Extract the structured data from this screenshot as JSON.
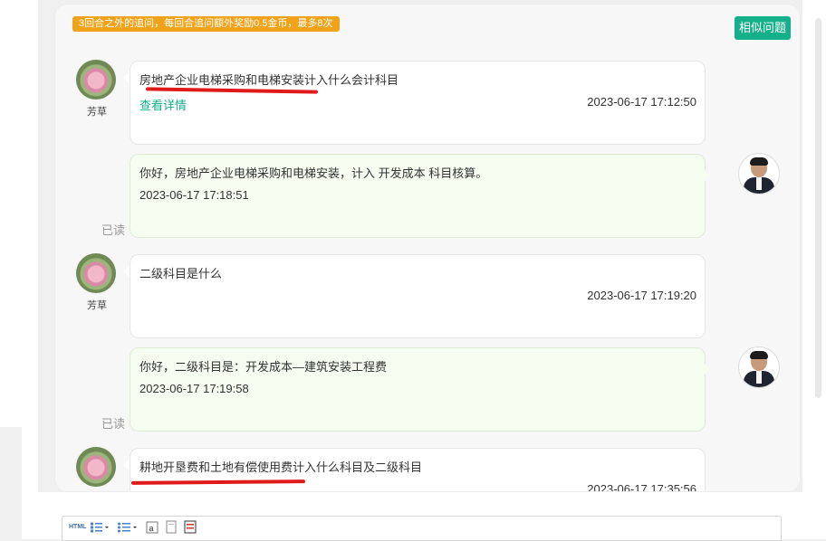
{
  "notice": "3回合之外的追问，每回合追问额外奖励0.5金币，最多8次",
  "similar_button": "相似问题",
  "messages": [
    {
      "user": "芳草",
      "text": "房地产企业电梯采购和电梯安装计入什么会计科目",
      "link": "查看详情",
      "time": "2023-06-17 17:12:50"
    },
    {
      "text": "你好，房地产企业电梯采购和电梯安装，计入  开发成本  科目核算。",
      "time": "2023-06-17 17:18:51",
      "status": "已读"
    },
    {
      "user": "芳草",
      "text": "二级科目是什么",
      "time": "2023-06-17 17:19:20"
    },
    {
      "text": "你好，二级科目是：开发成本—建筑安装工程费",
      "time": "2023-06-17 17:19:58",
      "status": "已读"
    },
    {
      "user": "芳草",
      "text": "耕地开垦费和土地有偿使用费计入什么科目及二级科目",
      "time": "2023-06-17 17:35:56"
    }
  ],
  "toolbar": {
    "html": "HTML",
    "ordered_list_icon": "ordered-list-icon",
    "unordered_list_icon": "unordered-list-icon",
    "font_icon": "font-icon",
    "paste_icon": "paste-icon",
    "template_icon": "template-icon"
  },
  "colors": {
    "accent": "#14b08a",
    "notice_bg": "#f0a21a",
    "reply_bg": "#f4fdf0",
    "annotation": "#e01a1a"
  }
}
